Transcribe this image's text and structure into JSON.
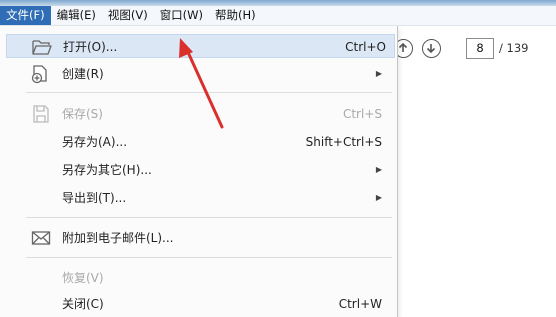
{
  "menubar": {
    "items": [
      {
        "label": "文件(F)",
        "active": true
      },
      {
        "label": "编辑(E)"
      },
      {
        "label": "视图(V)"
      },
      {
        "label": "窗口(W)"
      },
      {
        "label": "帮助(H)"
      }
    ]
  },
  "toolbar": {
    "page_current": "8",
    "page_total": "/ 139",
    "prev_icon": "arrow-up-circle-icon",
    "next_icon": "arrow-down-circle-icon"
  },
  "menu": {
    "items": [
      {
        "label": "打开(O)...",
        "shortcut": "Ctrl+O",
        "icon": "folder-open-icon",
        "highlighted": true
      },
      {
        "label": "创建(R)",
        "submenu": true,
        "icon": "create-document-icon"
      },
      {
        "label": "保存(S)",
        "shortcut": "Ctrl+S",
        "icon": "save-icon",
        "disabled": true
      },
      {
        "label": "另存为(A)...",
        "shortcut": "Shift+Ctrl+S"
      },
      {
        "label": "另存为其它(H)...",
        "submenu": true
      },
      {
        "label": "导出到(T)...",
        "submenu": true
      },
      {
        "label": "附加到电子邮件(L)...",
        "icon": "envelope-icon"
      },
      {
        "label": "恢复(V)",
        "disabled": true
      },
      {
        "label": "关闭(C)",
        "shortcut": "Ctrl+W"
      }
    ],
    "submenu_arrow": "▶"
  },
  "colors": {
    "menubar_active": "#2f6db7",
    "highlight": "#dbe7f5",
    "annotation_arrow": "#d9302c"
  }
}
